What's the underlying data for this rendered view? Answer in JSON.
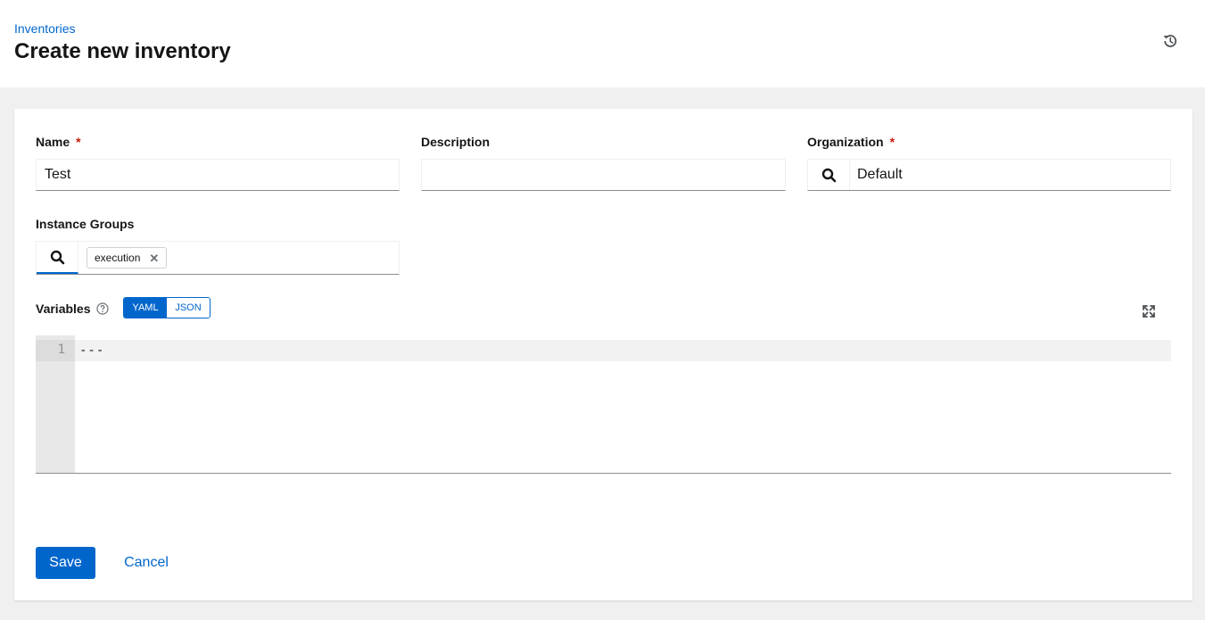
{
  "breadcrumb": {
    "parent": "Inventories"
  },
  "header": {
    "title": "Create new inventory",
    "history_icon": "history-icon"
  },
  "form": {
    "name": {
      "label": "Name",
      "required_mark": "*",
      "value": "Test"
    },
    "description": {
      "label": "Description",
      "value": ""
    },
    "organization": {
      "label": "Organization",
      "required_mark": "*",
      "value": "Default",
      "icon": "search-icon"
    },
    "instance_groups": {
      "label": "Instance Groups",
      "icon": "search-icon",
      "chips": [
        {
          "label": "execution",
          "remove_icon": "close-icon"
        }
      ]
    },
    "variables": {
      "label": "Variables",
      "help_icon": "help-icon",
      "modes": [
        "YAML",
        "JSON"
      ],
      "selected_mode": "YAML",
      "expand_icon": "expand-icon",
      "lines": [
        {
          "number": "1",
          "text": "---"
        }
      ]
    },
    "actions": {
      "save": "Save",
      "cancel": "Cancel"
    }
  },
  "colors": {
    "primary": "#0066cc",
    "required": "#c9190b",
    "background": "#f0f0f0"
  }
}
